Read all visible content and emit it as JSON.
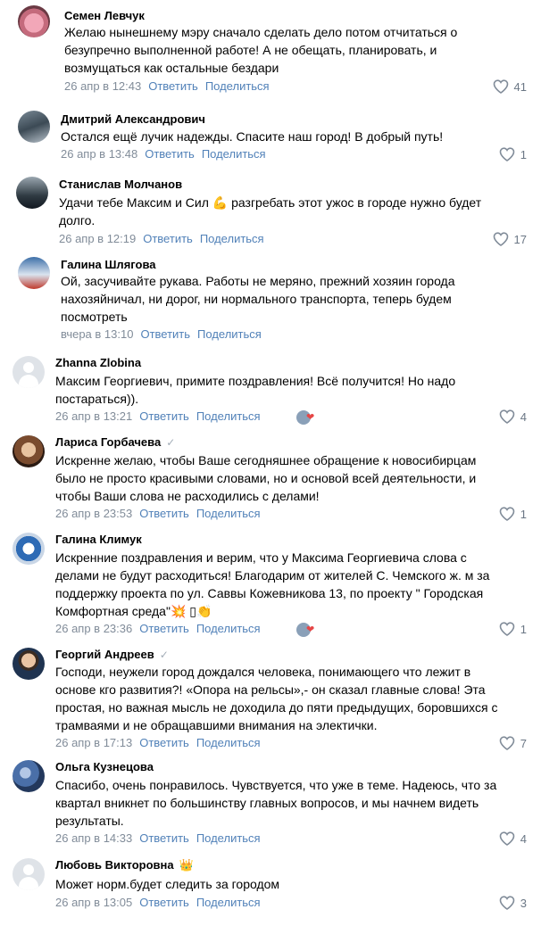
{
  "actions": {
    "reply": "Ответить",
    "share": "Поделиться"
  },
  "comments": [
    {
      "name": "Семен Левчук",
      "text": "Желаю нынешнему мэру сначало сделать дело потом отчитаться о безупречно выполненной работе! А не обещать, планировать, и возмущаться как остальные бездари",
      "date": "26 апр в 12:43",
      "likes": "41"
    },
    {
      "name": "Дмитрий Александрович",
      "text": "Остался ещё лучик надежды. Спасите наш город! В добрый путь!",
      "date": "26 апр в 13:48",
      "likes": "1"
    },
    {
      "name": "Станислав Молчанов",
      "text": "Удачи тебе Максим и Сил 💪 разгребать этот ужос в городе нужно будет долго.",
      "date": "26 апр в 12:19",
      "likes": "17"
    },
    {
      "name": "Галина Шлягова",
      "text": "Ой, засучивайте рукава. Работы не меряно, прежний хозяин города нахозяйничал, ни дорог, ни нормального транспорта, теперь будем посмотреть",
      "date": "вчера в 13:10",
      "likes": ""
    },
    {
      "name": "Zhanna Zlobina",
      "text": "Максим Георгиевич, примите поздравления! Всё получится! Но надо постараться)).",
      "date": "26 апр в 13:21",
      "likes": "4"
    },
    {
      "name": "Лариса Горбачева",
      "text": "Искренне желаю, чтобы Ваше сегодняшнее обращение к новосибирцам было не просто красивыми словами, но и основой всей деятельности, и чтобы Ваши слова не расходились с делами!",
      "date": "26 апр в 23:53",
      "likes": "1"
    },
    {
      "name": "Галина Климук",
      "text": "Искренние поздравления и верим, что у Максима Георгиевича слова с делами не будут расходиться! Благодарим от жителей С. Чемского ж. м за поддержку проекта по ул. Саввы Кожевникова 13, по проекту \" Городская Комфортная среда\"💥 ▯👏",
      "date": "26 апр в 23:36",
      "likes": "1"
    },
    {
      "name": "Георгий Андреев",
      "text": "Господи, неужели город дождался человека, понимающего что лежит в основе кго развития?! «Опора на рельсы»,- он сказал главные слова! Эта простая, но важная мысль не доходила до пяти предыдущих, боровшихся с трамваями и не обращавшими внимания на электички.",
      "date": "26 апр в 17:13",
      "likes": "7"
    },
    {
      "name": "Ольга Кузнецова",
      "text": "Спасибо, очень понравилось. Чувствуется, что уже в теме. Надеюсь, что за квартал вникнет по большинству главных вопросов, и мы начнем видеть результаты.",
      "date": "26 апр в 14:33",
      "likes": "4"
    },
    {
      "name": "Любовь Викторовна",
      "text": "Может норм.будет следить за городом",
      "date": "26 апр в 13:05",
      "likes": "3"
    }
  ],
  "colors": {
    "link": "#5181b8",
    "meta": "#818c99",
    "heart": "#e64646"
  }
}
